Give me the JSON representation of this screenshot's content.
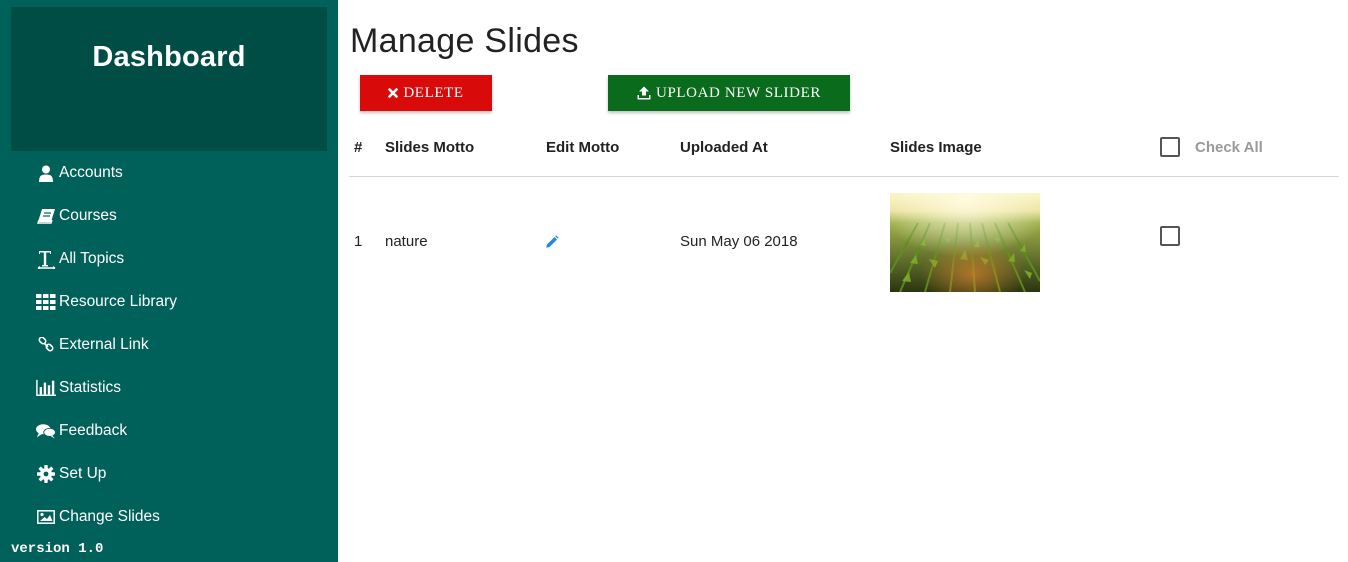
{
  "sidebar": {
    "title": "Dashboard",
    "items": [
      {
        "label": "Accounts",
        "icon": "user-icon"
      },
      {
        "label": "Courses",
        "icon": "book-icon"
      },
      {
        "label": "All Topics",
        "icon": "text-height-icon"
      },
      {
        "label": "Resource Library",
        "icon": "grid-icon"
      },
      {
        "label": "External Link",
        "icon": "link-icon"
      },
      {
        "label": "Statistics",
        "icon": "bar-chart-icon"
      },
      {
        "label": "Feedback",
        "icon": "comments-icon"
      },
      {
        "label": "Set Up",
        "icon": "gear-icon"
      },
      {
        "label": "Change Slides",
        "icon": "image-icon"
      }
    ],
    "version": "version 1.0"
  },
  "main": {
    "title": "Manage Slides",
    "delete_label": "DELETE",
    "upload_label": "UPLOAD NEW SLIDER"
  },
  "table": {
    "columns": [
      "#",
      "Slides Motto",
      "Edit Motto",
      "Uploaded At",
      "Slides Image"
    ],
    "check_all_label": "Check All",
    "rows": [
      {
        "index": "1",
        "motto": "nature",
        "uploaded_at": "Sun May 06 2018",
        "image": "corn field at sunrise"
      }
    ]
  },
  "colors": {
    "sidebar": "#00605a",
    "brand_panel": "#004d45",
    "delete": "#d90a0a",
    "upload": "#0a6b1d",
    "edit_icon": "#1e88e5"
  }
}
